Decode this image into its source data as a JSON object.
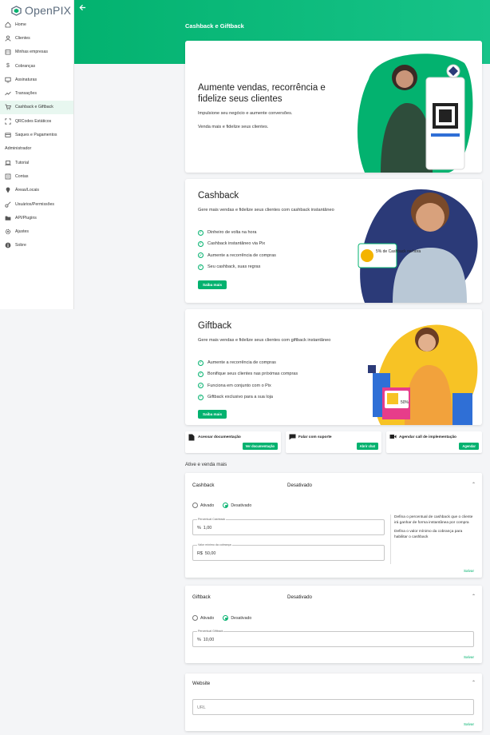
{
  "app": {
    "name": "OpenPIX"
  },
  "sidebar": {
    "items": [
      {
        "label": "Home",
        "icon": "home-icon"
      },
      {
        "label": "Clientes",
        "icon": "user-icon"
      },
      {
        "label": "Minhas empresas",
        "icon": "building-icon"
      },
      {
        "label": "Cobranças",
        "icon": "dollar-icon"
      },
      {
        "label": "Assinaturas",
        "icon": "monitor-icon"
      },
      {
        "label": "Transações",
        "icon": "trend-icon"
      },
      {
        "label": "Cashback e Giftback",
        "icon": "cart-icon"
      },
      {
        "label": "QRCodes Estáticos",
        "icon": "qrcode-icon"
      },
      {
        "label": "Saques e Pagamentos",
        "icon": "wallet-icon"
      }
    ],
    "admin_section": "Administrador",
    "admin_items": [
      {
        "label": "Tutorial",
        "icon": "laptop-icon"
      },
      {
        "label": "Contas",
        "icon": "account-icon"
      },
      {
        "label": "Áreas/Locais",
        "icon": "pin-icon"
      },
      {
        "label": "Usuários/Permissões",
        "icon": "key-icon"
      },
      {
        "label": "API/Plugins",
        "icon": "folder-icon"
      },
      {
        "label": "Ajustes",
        "icon": "gear-icon"
      },
      {
        "label": "Sobre",
        "icon": "info-icon"
      }
    ],
    "active_index": 6
  },
  "header": {
    "title": "Cashback e Giftback"
  },
  "hero": {
    "title": "Aumente vendas, recorrência e fidelize seus clientes",
    "line1": "Impulsione seu negócio e aumente conversões.",
    "line2": "Venda mais e fidelize seus clientes."
  },
  "cashback_card": {
    "title": "Cashback",
    "subtitle": "Gere mais vendas e fidelize seus clientes com cashback instantâneo",
    "bullets": [
      "Dinheiro de volta na hora",
      "Cashback instantâneo via Pix",
      "Aumente a recorrência de compras",
      "Seu cashback, suas regras"
    ],
    "button": "Saiba mais",
    "badge_text": "5% de Cashback na hora"
  },
  "giftback_card": {
    "title": "Giftback",
    "subtitle": "Gere mais vendas e fidelize seus clientes com giftback instantâneo",
    "bullets": [
      "Aumente a recorrência de compras",
      "Bonifique seus clientes nas próximas compras",
      "Funciona em conjunto com o Pix",
      "Giftback exclusivo para a sua loja"
    ],
    "button": "Saiba mais",
    "badge_text": "50%"
  },
  "actions": [
    {
      "label": "Acessar documentação",
      "button": "Ver documentação",
      "icon": "document-icon"
    },
    {
      "label": "Falar com suporte",
      "button": "Abrir chat",
      "icon": "chat-icon"
    },
    {
      "label": "Agendar call de implementação",
      "button": "Agendar",
      "icon": "video-icon"
    }
  ],
  "settings_title": "Ative e venda mais",
  "cashback_panel": {
    "title": "Cashback",
    "status": "Desativado",
    "radio_on": "Ativado",
    "radio_off": "Desativado",
    "percent_label": "Percentual Cashback",
    "percent_prefix": "%",
    "percent_value": "1,00",
    "min_label": "Valor mínimo da cobrança",
    "min_prefix": "R$",
    "min_value": "50,00",
    "help1": "Defina o percentual de cashback que o cliente irá ganhar de forma instantânea por compra",
    "help2": "Defina o valor mínimo da cobrança para habilitar o cashback",
    "save": "Salvar"
  },
  "giftback_panel": {
    "title": "Giftback",
    "status": "Desativado",
    "radio_on": "Ativado",
    "radio_off": "Desativado",
    "percent_label": "Percentual Giftback",
    "percent_prefix": "%",
    "percent_value": "10,00",
    "save": "Salvar"
  },
  "website_panel": {
    "title": "Website",
    "url_placeholder": "URL",
    "save": "Salvar"
  },
  "colors": {
    "accent": "#03b26f",
    "accent_light": "#e8f7f0"
  }
}
